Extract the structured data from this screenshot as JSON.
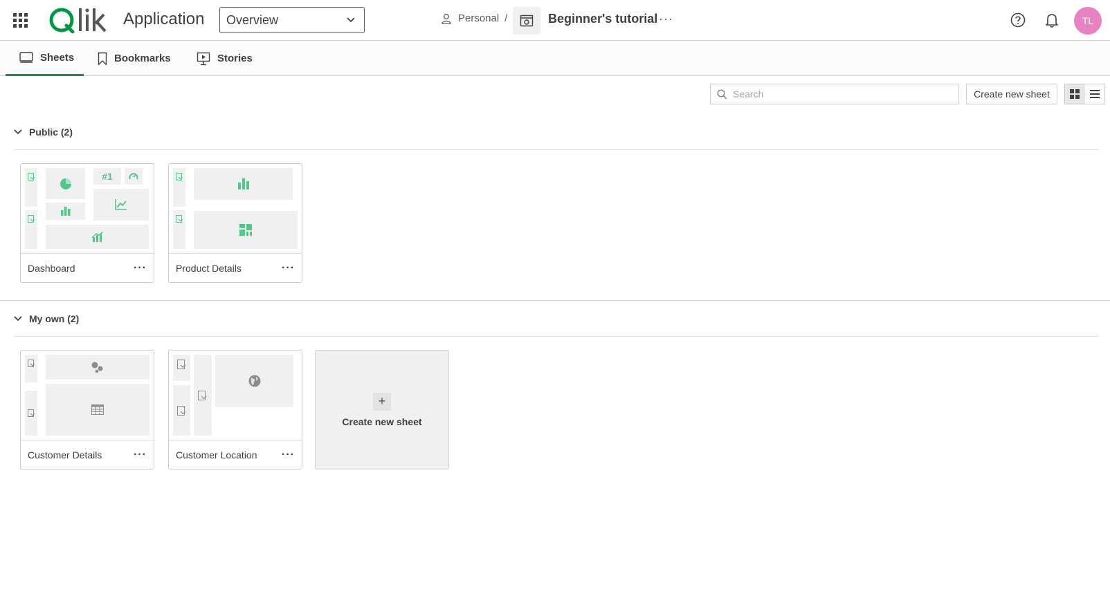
{
  "header": {
    "app_title": "Application",
    "sheet_select": {
      "value": "Overview"
    },
    "breadcrumb": {
      "space": "Personal",
      "separator": "/"
    },
    "app_name": "Beginner's tutorial",
    "more": "···",
    "avatar_initials": "TL",
    "avatar_color": "#e882c2"
  },
  "tabs": [
    {
      "label": "Sheets",
      "active": true
    },
    {
      "label": "Bookmarks",
      "active": false
    },
    {
      "label": "Stories",
      "active": false
    }
  ],
  "toolbar": {
    "search_placeholder": "Search",
    "create_label": "Create new sheet",
    "view_mode": "grid"
  },
  "sections": [
    {
      "title": "Public (2)",
      "sheets": [
        {
          "title": "Dashboard",
          "menu": "···",
          "icons": [
            "pie-chart",
            "kpi",
            "gauge",
            "bar-chart",
            "line-chart",
            "combo-chart"
          ]
        },
        {
          "title": "Product Details",
          "menu": "···",
          "icons": [
            "bar-chart",
            "treemap"
          ]
        }
      ]
    },
    {
      "title": "My own (2)",
      "sheets": [
        {
          "title": "Customer Details",
          "menu": "···",
          "icons": [
            "scatter-plot",
            "table"
          ]
        },
        {
          "title": "Customer Location",
          "menu": "···",
          "icons": [
            "map"
          ]
        }
      ],
      "create_label": "Create new sheet"
    }
  ],
  "colors": {
    "accent_green": "#1d8a4a",
    "chart_green": "#52c788",
    "text": "#404040"
  }
}
